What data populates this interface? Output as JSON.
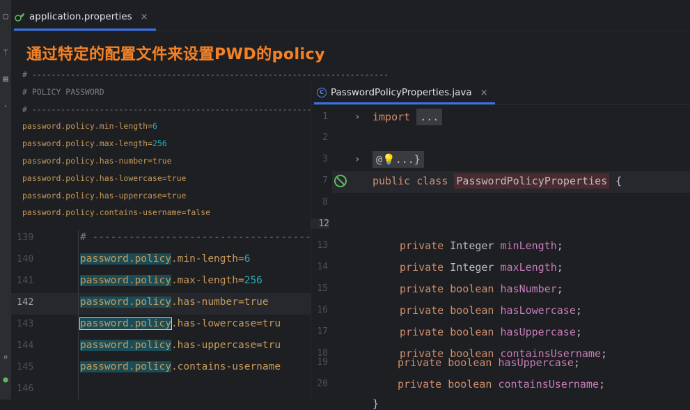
{
  "background_editor": {
    "tab": {
      "label": "application.properties",
      "close": "×"
    },
    "headline": "通过特定的配置文件来设置PWD的policy",
    "snippet_lines": [
      {
        "type": "comment",
        "text": "# --------------------------------------------------------------------------"
      },
      {
        "type": "comment",
        "text": "# POLICY PASSWORD"
      },
      {
        "type": "comment",
        "text": "# --------------------------------------------------------------------------"
      },
      {
        "type": "prop",
        "key": "password.policy.min-length=",
        "value": "6",
        "value_type": "number"
      },
      {
        "type": "prop",
        "key": "password.policy.max-length=",
        "value": "256",
        "value_type": "number"
      },
      {
        "type": "prop",
        "key": "password.policy.has-number=",
        "value": "true",
        "value_type": "text"
      },
      {
        "type": "prop",
        "key": "password.policy.has-lowercase=",
        "value": "true",
        "value_type": "text"
      },
      {
        "type": "prop",
        "key": "password.policy.has-uppercase=",
        "value": "true",
        "value_type": "text"
      },
      {
        "type": "prop",
        "key": "password.policy.contains-username=",
        "value": "false",
        "value_type": "text"
      }
    ],
    "lower_lines": [
      {
        "num": "139",
        "comment": "# -------------------------------------------"
      },
      {
        "num": "140",
        "key": "password.policy",
        "rest": ".min-length=",
        "value": "6",
        "value_type": "number"
      },
      {
        "num": "141",
        "key": "password.policy",
        "rest": ".max-length=",
        "value": "256",
        "value_type": "number"
      },
      {
        "num": "142",
        "key": "password.policy",
        "rest": ".has-number=",
        "value": "true",
        "value_type": "text",
        "current": true
      },
      {
        "num": "143",
        "key": "password.policy",
        "rest": ".has-lowercase=",
        "value": "tru",
        "value_type": "text",
        "boxed": true
      },
      {
        "num": "144",
        "key": "password.policy",
        "rest": ".has-uppercase=",
        "value": "tru",
        "value_type": "text"
      },
      {
        "num": "145",
        "key": "password.policy",
        "rest": ".contains-username",
        "value": "",
        "value_type": "text"
      },
      {
        "num": "146"
      }
    ]
  },
  "java_editor": {
    "tab": {
      "label": "PasswordPolicyProperties.java",
      "close": "×"
    },
    "lines": [
      {
        "num": "1",
        "fold": "›",
        "parts": [
          {
            "k": "kw",
            "t": "import "
          },
          {
            "k": "folded",
            "t": "..."
          }
        ]
      },
      {
        "num": "2",
        "parts": []
      },
      {
        "num": "3",
        "fold": "›",
        "parts": [
          {
            "k": "folded",
            "t": "@💡...}"
          }
        ]
      },
      {
        "num": "7",
        "gutter_icon": "no-usages-icon",
        "current": true,
        "parts": [
          {
            "k": "kw",
            "t": "public class "
          },
          {
            "k": "cls",
            "t": "PasswordPolicyProperties"
          },
          {
            "k": "typ",
            "t": " {"
          }
        ]
      },
      {
        "num": "8",
        "parts": []
      },
      {
        "num": "12",
        "current_num": true,
        "parts": []
      },
      {
        "num": "13",
        "parts": [
          {
            "k": "kw",
            "t": "private "
          },
          {
            "k": "typ",
            "t": "Integer "
          },
          {
            "k": "fld",
            "t": "minLength"
          },
          {
            "k": "typ",
            "t": ";"
          }
        ]
      },
      {
        "num": "14",
        "parts": [
          {
            "k": "kw",
            "t": "private "
          },
          {
            "k": "typ",
            "t": "Integer "
          },
          {
            "k": "fld",
            "t": "maxLength"
          },
          {
            "k": "typ",
            "t": ";"
          }
        ]
      },
      {
        "num": "15",
        "parts": [
          {
            "k": "kw",
            "t": "private "
          },
          {
            "k": "kw",
            "t": "boolean "
          },
          {
            "k": "fld",
            "t": "hasNumber"
          },
          {
            "k": "typ",
            "t": ";"
          }
        ]
      },
      {
        "num": "16",
        "parts": [
          {
            "k": "kw",
            "t": "private "
          },
          {
            "k": "kw",
            "t": "boolean "
          },
          {
            "k": "fld",
            "t": "hasLowercase"
          },
          {
            "k": "typ",
            "t": ";"
          }
        ]
      },
      {
        "num": "17",
        "parts": [
          {
            "k": "kw",
            "t": "private "
          },
          {
            "k": "kw",
            "t": "boolean "
          },
          {
            "k": "fld",
            "t": "hasUppercase"
          },
          {
            "k": "typ",
            "t": ";"
          }
        ]
      },
      {
        "num": "18",
        "parts": [
          {
            "k": "kw",
            "t": "private "
          },
          {
            "k": "kw",
            "t": "boolean "
          },
          {
            "k": "fld",
            "t": "containsUsername"
          },
          {
            "k": "typ",
            "t": ";"
          }
        ]
      },
      {
        "num": "19",
        "parts": [
          {
            "k": "kw",
            "t": "private "
          },
          {
            "k": "kw",
            "t": "boolean "
          },
          {
            "k": "fld",
            "t": "hasUppercase"
          },
          {
            "k": "typ",
            "t": ";"
          }
        ]
      },
      {
        "num": "20",
        "parts": [
          {
            "k": "kw",
            "t": "private "
          },
          {
            "k": "kw",
            "t": "boolean "
          },
          {
            "k": "fld",
            "t": "containsUsername"
          },
          {
            "k": "typ",
            "t": ";"
          }
        ]
      },
      {
        "num": "",
        "parts": [
          {
            "k": "typ",
            "t": "}"
          }
        ]
      }
    ]
  },
  "colors": {
    "accent": "#3574f0",
    "headline": "#f0822a",
    "keyword": "#cf8e6d",
    "field": "#c77dbb",
    "property_key": "#c69a5a",
    "number": "#2aacb8"
  },
  "icons": [
    "gear-leaf-icon",
    "class-c-icon",
    "chevron-right-icon",
    "no-usages-icon"
  ]
}
